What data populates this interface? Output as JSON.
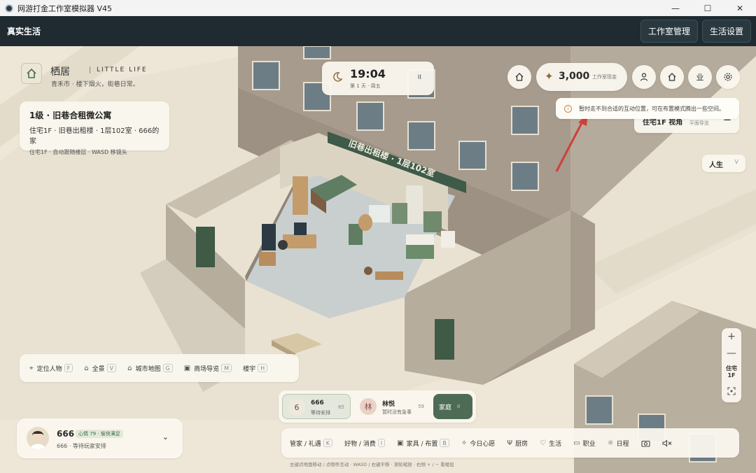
{
  "window": {
    "title": "网游打金工作室模拟器 V45",
    "controls": [
      "—",
      "☐",
      "✕"
    ]
  },
  "appbar": {
    "brand": "真实生活",
    "studio_button": "工作室管理",
    "life_settings_button": "生活设置"
  },
  "brand": {
    "title": "栖居",
    "subtitle": "LITTLE LIFE",
    "tagline": "青禾市 · 楼下烟火，街巷日常。"
  },
  "location": {
    "title": "1级 · 旧巷合租微公寓",
    "detail": "住宅1F · 旧巷出租楼 · 1层102室 · 666的家",
    "hint": "住宅1F · 自动跟随楼层 · WASD 移镜头"
  },
  "clock": {
    "time": "19:04",
    "date": "第 1 天 · 周五",
    "pause": "II"
  },
  "cash": {
    "amount": "3,000",
    "label": "工作室现金"
  },
  "top_buttons": [
    "人",
    "家",
    "业"
  ],
  "toast": {
    "message": "暂时走不到合适的互动位置，可在布置模式腾出一些空间。"
  },
  "floor_panel": {
    "label": "住宅1F 视角",
    "sub": "平面导览",
    "minimize": "—"
  },
  "life_select": {
    "label": "人生",
    "chevron": "V"
  },
  "zoom": {
    "plus": "+",
    "minus": "—",
    "floor_line1": "住宅",
    "floor_line2": "1F"
  },
  "building_sign": "旧巷出租楼 · 1层102室",
  "navbar": [
    {
      "label": "定位人物",
      "key": "F"
    },
    {
      "label": "全景",
      "key": "V"
    },
    {
      "label": "城市地图",
      "key": "G"
    },
    {
      "label": "商场导览",
      "key": "M"
    },
    {
      "label": "楼宇",
      "key": "H"
    }
  ],
  "character": {
    "name": "666",
    "mood": "心情 79 · 愉快满足",
    "status": "666 · 等待玩家安排"
  },
  "roster": [
    {
      "initial": "6",
      "name": "666",
      "status": "等待安排",
      "value": "65"
    },
    {
      "initial": "林",
      "name": "林悦",
      "status": "暂时没有急事",
      "value": "59"
    }
  ],
  "family_button": {
    "label": "家庭",
    "key": "II"
  },
  "actions": [
    {
      "label": "管家 / 礼遇",
      "key": "K"
    },
    {
      "label": "好物 / 消费",
      "key": "I"
    },
    {
      "label": "家具 / 布置",
      "key": "B"
    },
    {
      "label": "今日心愿"
    },
    {
      "label": "厨房"
    },
    {
      "label": "生活"
    },
    {
      "label": "职业"
    },
    {
      "label": "日程"
    }
  ],
  "hint": "左键点地面移动 / 点物件互动  ·  WASD / 右键平移 · 滚轮缩放 · 右侧 + / − 看楼层"
}
